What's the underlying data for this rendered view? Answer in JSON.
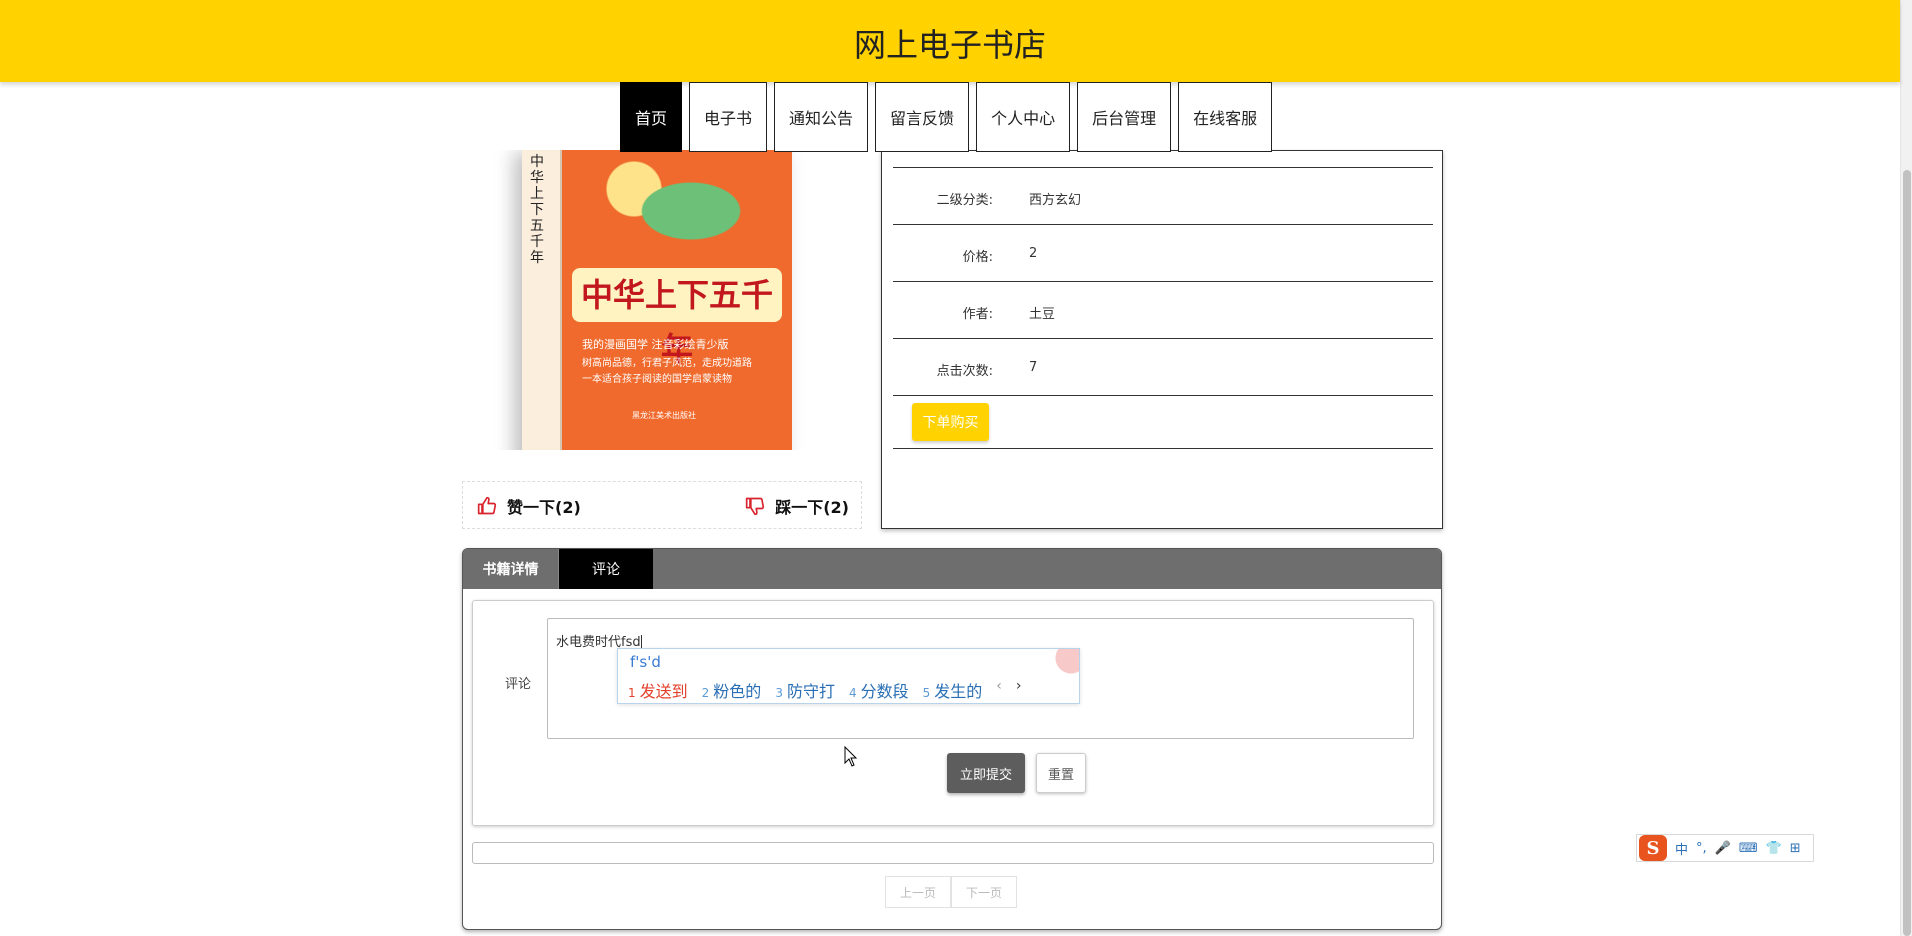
{
  "header": {
    "site_title": "网上电子书店"
  },
  "nav": {
    "items": [
      {
        "label": "首页",
        "active": true
      },
      {
        "label": "电子书"
      },
      {
        "label": "通知公告"
      },
      {
        "label": "留言反馈"
      },
      {
        "label": "个人中心"
      },
      {
        "label": "后台管理"
      },
      {
        "label": "在线客服"
      }
    ]
  },
  "book": {
    "cover": {
      "title": "中华上下五千年",
      "spine_text": "中华上下五千年",
      "line1": "我的漫画国学 注音彩绘青少版",
      "line2": "树高尚品德，行君子风范，走成功道路",
      "line3": "一本适合孩子阅读的国学启蒙读物",
      "publisher": "黑龙江美术出版社"
    },
    "info": [
      {
        "label": "二级分类:",
        "value": "西方玄幻"
      },
      {
        "label": "价格:",
        "value": "2"
      },
      {
        "label": "作者:",
        "value": "土豆"
      },
      {
        "label": "点击次数:",
        "value": "7"
      }
    ],
    "buy_label": "下单购买",
    "like_label": "赞一下(2)",
    "dislike_label": "踩一下(2)"
  },
  "tabs": {
    "book_details": "书籍详情",
    "comments": "评论"
  },
  "comment_form": {
    "label": "评论",
    "text": "水电费时代fsd",
    "submit_label": "立即提交",
    "reset_label": "重置"
  },
  "ime": {
    "input": "f's'd",
    "candidates": [
      {
        "num": "1",
        "text": "发送到"
      },
      {
        "num": "2",
        "text": "粉色的"
      },
      {
        "num": "3",
        "text": "防守打"
      },
      {
        "num": "4",
        "text": "分数段"
      },
      {
        "num": "5",
        "text": "发生的"
      }
    ],
    "prev": "‹",
    "next": "›",
    "toolbar": {
      "logo": "S",
      "mode": "中",
      "punct": "°,",
      "voice": "🎤",
      "keyboard": "⌨",
      "skin": "👕",
      "menu": "⊞"
    }
  },
  "pager": {
    "prev_label": "上一页",
    "next_label": "下一页"
  },
  "colors": {
    "brand_yellow": "#ffd200",
    "tab_gray": "#6e6e6e",
    "nav_active": "#000000"
  }
}
